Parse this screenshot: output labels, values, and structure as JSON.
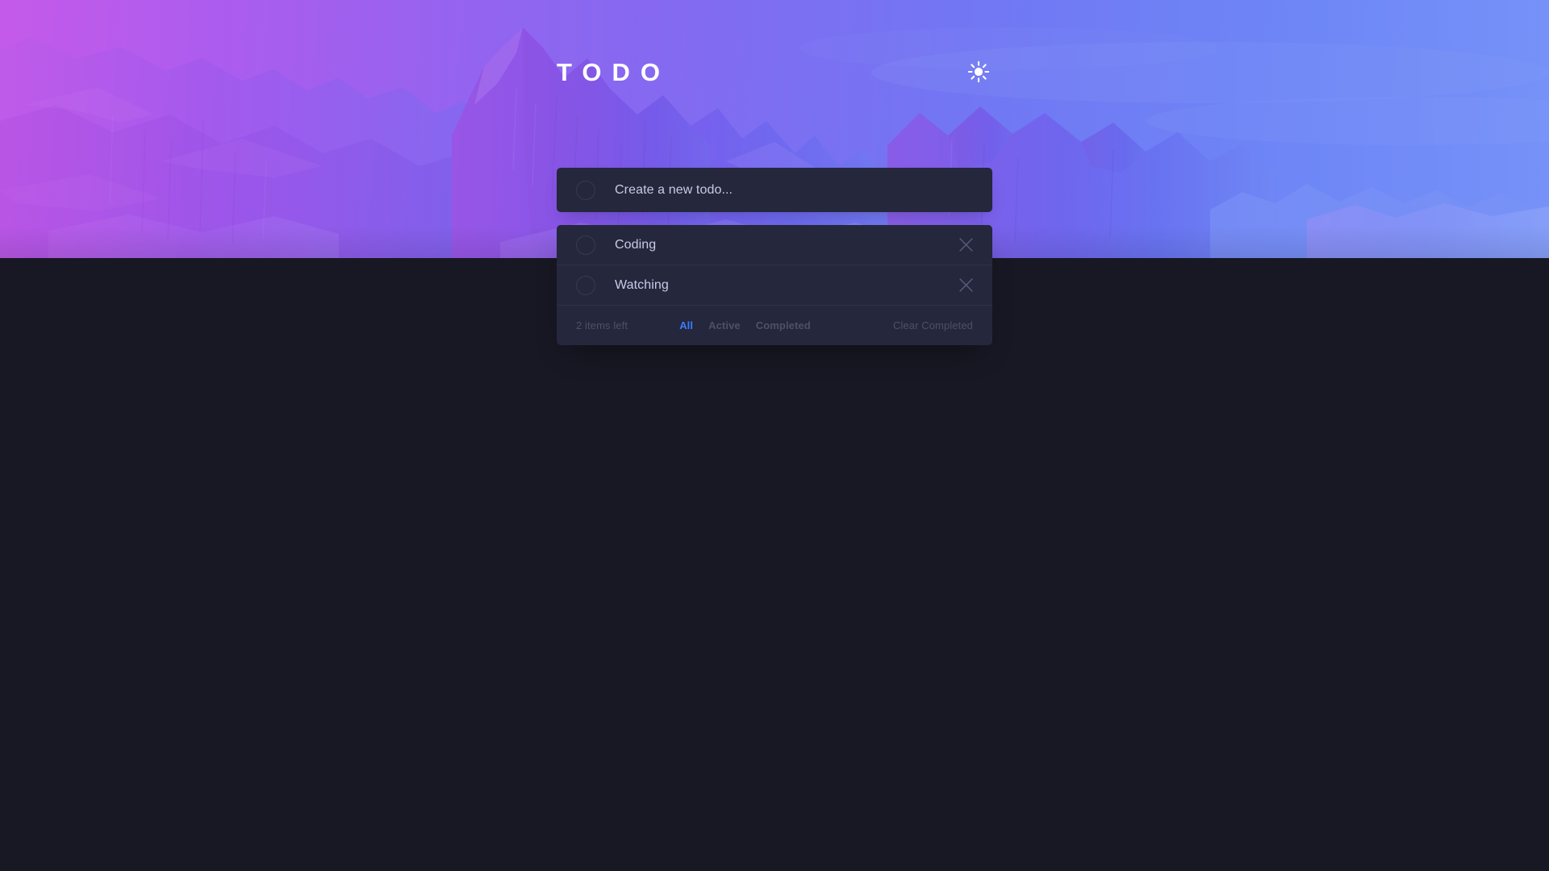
{
  "theme": {
    "mode": "dark",
    "page_background": "#171823",
    "card_background": "#25273d",
    "accent": "#3a7cfd",
    "text_primary": "#c8cbe7",
    "text_muted": "#4d5067",
    "divider": "#2f3150",
    "circle_border": "#393a4b",
    "hero_gradient_from": "#c850eb",
    "hero_gradient_to": "#6082f8"
  },
  "header": {
    "title": "TODO",
    "theme_toggle_icon": "sun-icon"
  },
  "new_todo": {
    "placeholder": "Create a new todo...",
    "value": "",
    "checkbox_icon": "empty-circle-icon"
  },
  "todos": [
    {
      "label": "Coding",
      "completed": false,
      "delete_icon": "close-x-icon",
      "checkbox_icon": "empty-circle-icon"
    },
    {
      "label": "Watching",
      "completed": false,
      "delete_icon": "close-x-icon",
      "checkbox_icon": "empty-circle-icon"
    }
  ],
  "footer": {
    "items_left": "2 items left",
    "filters": [
      {
        "label": "All",
        "active": true
      },
      {
        "label": "Active",
        "active": false
      },
      {
        "label": "Completed",
        "active": false
      }
    ],
    "clear_label": "Clear Completed"
  }
}
